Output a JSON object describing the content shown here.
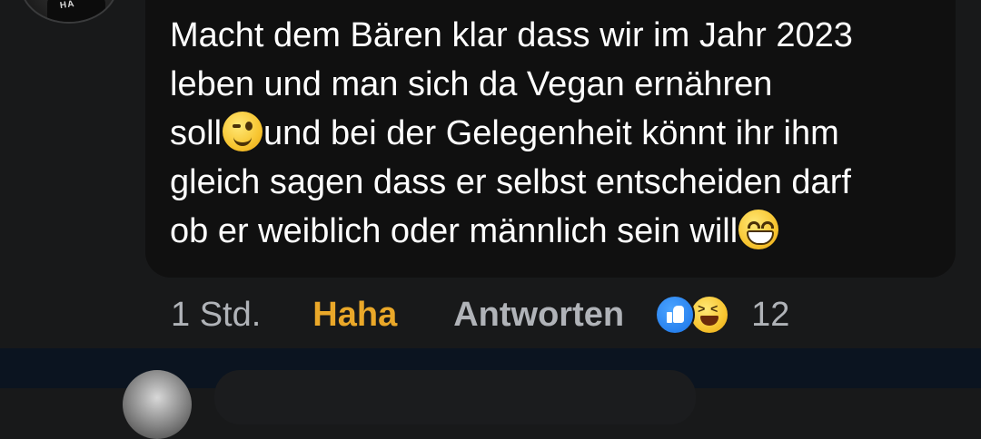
{
  "comment": {
    "text_line1": "Macht dem Bären klar dass wir im Jahr 2023\nleben und man sich da Vegan ernähren\nsoll",
    "text_line2": "und bei der Gelegenheit könnt ihr ihm\ngleich sagen dass er selbst entscheiden darf\nob er weiblich oder männlich sein will",
    "emoji1": "winking-face",
    "emoji2": "grinning-face",
    "avatar": "user-avatar"
  },
  "actions": {
    "timestamp": "1 Std.",
    "reaction_label": "Haha",
    "reply_label": "Antworten",
    "reaction_count": "12",
    "reaction_icons": [
      "like-icon",
      "laugh-icon"
    ]
  },
  "colors": {
    "background": "#18191a",
    "bubble": "#101010",
    "text": "#ffffff",
    "muted": "#b0b3b8",
    "haha_active": "#eaa829",
    "like_blue": "#1a74e8",
    "bottom_bar": "#0b1420"
  }
}
